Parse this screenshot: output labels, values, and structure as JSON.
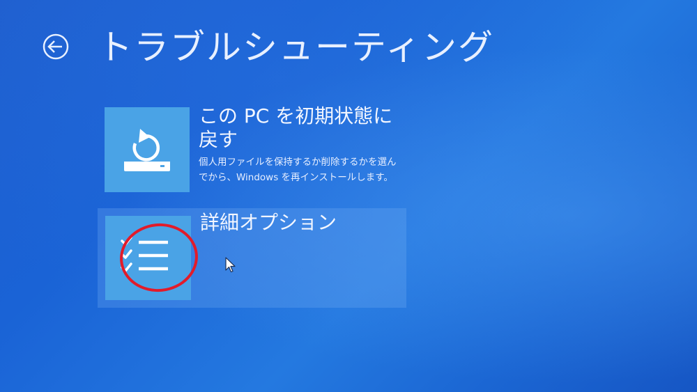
{
  "header": {
    "back_icon": "back-arrow-circle-icon",
    "title": "トラブルシューティング"
  },
  "options": [
    {
      "title": "この PC を初期状態に戻す",
      "description": "個人用ファイルを保持するか削除するかを選んでから、Windows を再インストールします。",
      "icon": "reset-pc-icon"
    },
    {
      "title": "詳細オプション",
      "description": "",
      "icon": "checklist-icon"
    }
  ],
  "colors": {
    "background": "#1a63d6",
    "tile": "#4aa3e6",
    "highlight_annotation": "#e21b2a"
  }
}
